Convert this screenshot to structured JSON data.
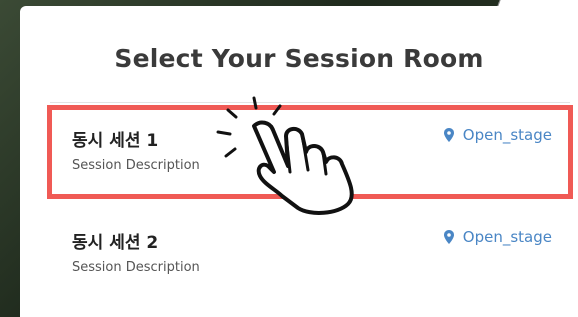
{
  "modal": {
    "title": "Select Your Session Room"
  },
  "sessions": [
    {
      "name": "동시 세션 1",
      "description": "Session Description",
      "room": "Open_stage",
      "selected": true
    },
    {
      "name": "동시 세션 2",
      "description": "Session Description",
      "room": "Open_stage",
      "selected": false
    }
  ],
  "colors": {
    "highlight": "#f05a55",
    "room_link": "#4a86c5",
    "title": "#3a3a3a"
  },
  "icons": {
    "room": "location-pin-icon",
    "pointer": "pointing-hand-icon"
  }
}
